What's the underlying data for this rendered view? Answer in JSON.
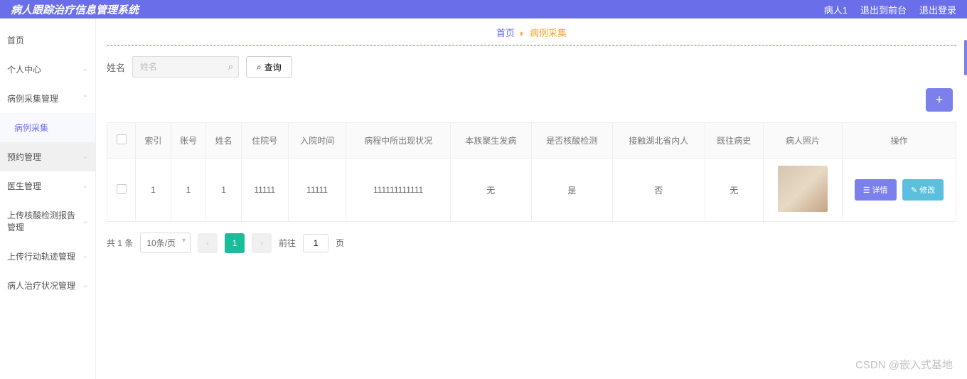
{
  "header": {
    "title": "病人跟踪治疗信息管理系统",
    "user": "病人1",
    "logout_front": "退出到前台",
    "logout": "退出登录"
  },
  "sidebar": {
    "items": [
      {
        "label": "首页",
        "expandable": false
      },
      {
        "label": "个人中心",
        "expandable": true
      },
      {
        "label": "病例采集管理",
        "expandable": true
      },
      {
        "label": "病例采集",
        "sub": true
      },
      {
        "label": "预约管理",
        "expandable": true,
        "highlight": true
      },
      {
        "label": "医生管理",
        "expandable": true
      },
      {
        "label": "上传核酸检测报告管理",
        "expandable": true
      },
      {
        "label": "上传行动轨迹管理",
        "expandable": true
      },
      {
        "label": "病人治疗状况管理",
        "expandable": true
      }
    ]
  },
  "breadcrumb": {
    "home": "首页",
    "current": "病例采集"
  },
  "search": {
    "label": "姓名",
    "placeholder": "姓名",
    "query_btn": "查询"
  },
  "table": {
    "headers": [
      "",
      "索引",
      "账号",
      "姓名",
      "住院号",
      "入院时间",
      "病程中所出现状况",
      "本族聚生发病",
      "是否核酸检测",
      "接触湖北省内人",
      "既往病史",
      "病人照片",
      "操作"
    ],
    "rows": [
      {
        "index": "1",
        "account": "1",
        "name": "1",
        "hospital_no": "11111",
        "admit_time": "11111",
        "status": "111111111111",
        "family": "无",
        "nucleic": "是",
        "hubei": "否",
        "history": "无"
      }
    ],
    "btn_detail": "详情",
    "btn_edit": "修改"
  },
  "pagination": {
    "total_text": "共 1 条",
    "per_page": "10条/页",
    "current": "1",
    "jump_prefix": "前往",
    "jump_value": "1",
    "jump_suffix": "页"
  },
  "watermark": "CSDN @嵌入式基地"
}
